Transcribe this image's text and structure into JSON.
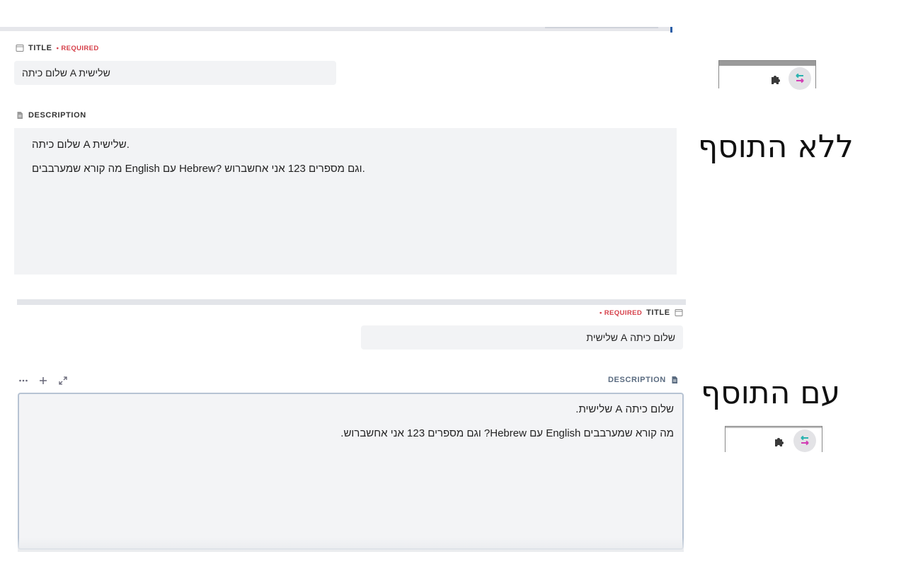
{
  "top": {
    "title_label": "TITLE",
    "required": "• REQUIRED",
    "title_value": "שלום כיתה A שלישית",
    "description_label": "DESCRIPTION",
    "description_lines": [
      "שלום כיתה A שלישית.",
      "מה קורא שמערבבים English עם Hebrew? וגם מספרים 123 אני אחשברוש."
    ]
  },
  "bottom": {
    "title_label": "TITLE",
    "required": "• REQUIRED",
    "title_value": "שלום כיתה A שלישית",
    "description_label": "DESCRIPTION",
    "toolbar": {
      "more_icon": "more-icon",
      "add_icon": "plus-icon",
      "expand_icon": "expand-icon"
    },
    "description_lines": [
      "שלום כיתה A שלישית.",
      "מה קורא שמערבבים English עם Hebrew? וגם מספרים 123 אני אחשברוש."
    ]
  },
  "captions": {
    "without_extension": "ללא התוסף",
    "with_extension": "עם התוסף"
  },
  "colors": {
    "required": "#d6404a",
    "field_bg": "#f2f3f5",
    "extension_pink": "#d23fb4",
    "extension_teal": "#2bb3b0"
  }
}
